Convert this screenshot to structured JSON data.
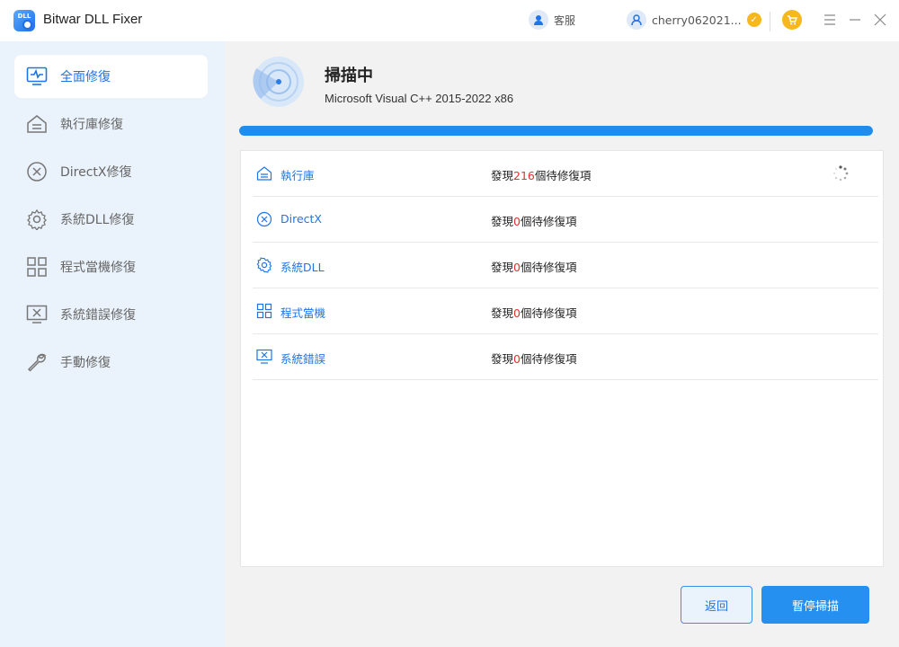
{
  "app": {
    "title": "Bitwar DLL Fixer",
    "logo_text": "DLL"
  },
  "header": {
    "support_label": "客服",
    "username": "cherry062021...",
    "vip_badge": "✓"
  },
  "sidebar": {
    "items": [
      {
        "label": "全面修復",
        "icon": "monitor-pulse-icon",
        "active": true
      },
      {
        "label": "執行庫修復",
        "icon": "library-icon",
        "active": false
      },
      {
        "label": "DirectX修復",
        "icon": "x-circle-icon",
        "active": false
      },
      {
        "label": "系統DLL修復",
        "icon": "gear-icon",
        "active": false
      },
      {
        "label": "程式當機修復",
        "icon": "grid-icon",
        "active": false
      },
      {
        "label": "系統錯誤修復",
        "icon": "monitor-x-icon",
        "active": false
      },
      {
        "label": "手動修復",
        "icon": "wrench-icon",
        "active": false
      }
    ]
  },
  "scan": {
    "title": "掃描中",
    "current_item": "Microsoft Visual C++ 2015-2022 x86",
    "progress": 1.0
  },
  "results": {
    "found_prefix": "發現",
    "found_suffix": "個待修復項",
    "rows": [
      {
        "label": "執行庫",
        "count": "216",
        "icon": "library-icon",
        "scanning": true
      },
      {
        "label": "DirectX",
        "count": "0",
        "icon": "x-circle-icon",
        "scanning": false
      },
      {
        "label": "系統DLL",
        "count": "0",
        "icon": "gear-icon",
        "scanning": false
      },
      {
        "label": "程式當機",
        "count": "0",
        "icon": "grid-icon",
        "scanning": false
      },
      {
        "label": "系統錯誤",
        "count": "0",
        "icon": "monitor-x-icon",
        "scanning": false
      }
    ]
  },
  "buttons": {
    "back": "返回",
    "pause": "暫停掃描"
  },
  "colors": {
    "accent": "#1f74e8",
    "progress": "#1f8cf0",
    "count_highlight": "#e0302f",
    "sidebar_bg": "#eaf2fb"
  }
}
